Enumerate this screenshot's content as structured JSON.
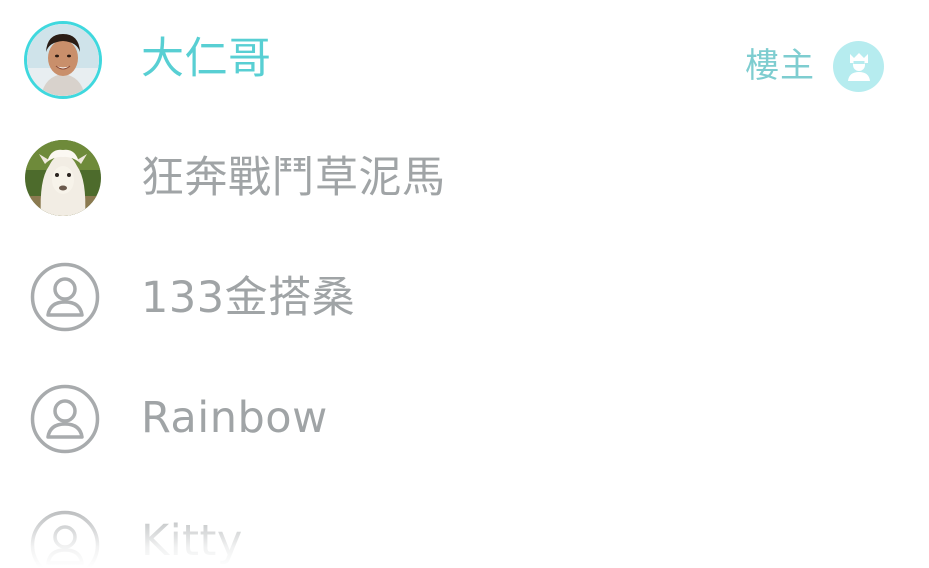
{
  "members": [
    {
      "name": "大仁哥",
      "is_owner": true,
      "avatar_icon": "user-photo-avatar-icon"
    },
    {
      "name": "狂奔戰鬥草泥馬",
      "is_owner": false,
      "avatar_icon": "alpaca-photo-avatar-icon"
    },
    {
      "name": "133金搭桑",
      "is_owner": false,
      "avatar_icon": "default-user-avatar-icon"
    },
    {
      "name": "Rainbow",
      "is_owner": false,
      "avatar_icon": "default-user-avatar-icon"
    },
    {
      "name": "Kitty",
      "is_owner": false,
      "avatar_icon": "default-user-avatar-icon"
    }
  ],
  "owner_badge": {
    "label": "樓主",
    "icon": "crown-user-icon"
  },
  "colors": {
    "accent": "#58cfd3",
    "owner_label": "#7ecdd0",
    "owner_icon_bg": "#b6ecef",
    "name_gray": "#a0a4a6",
    "icon_gray": "#a8abad",
    "background": "#ffffff"
  }
}
